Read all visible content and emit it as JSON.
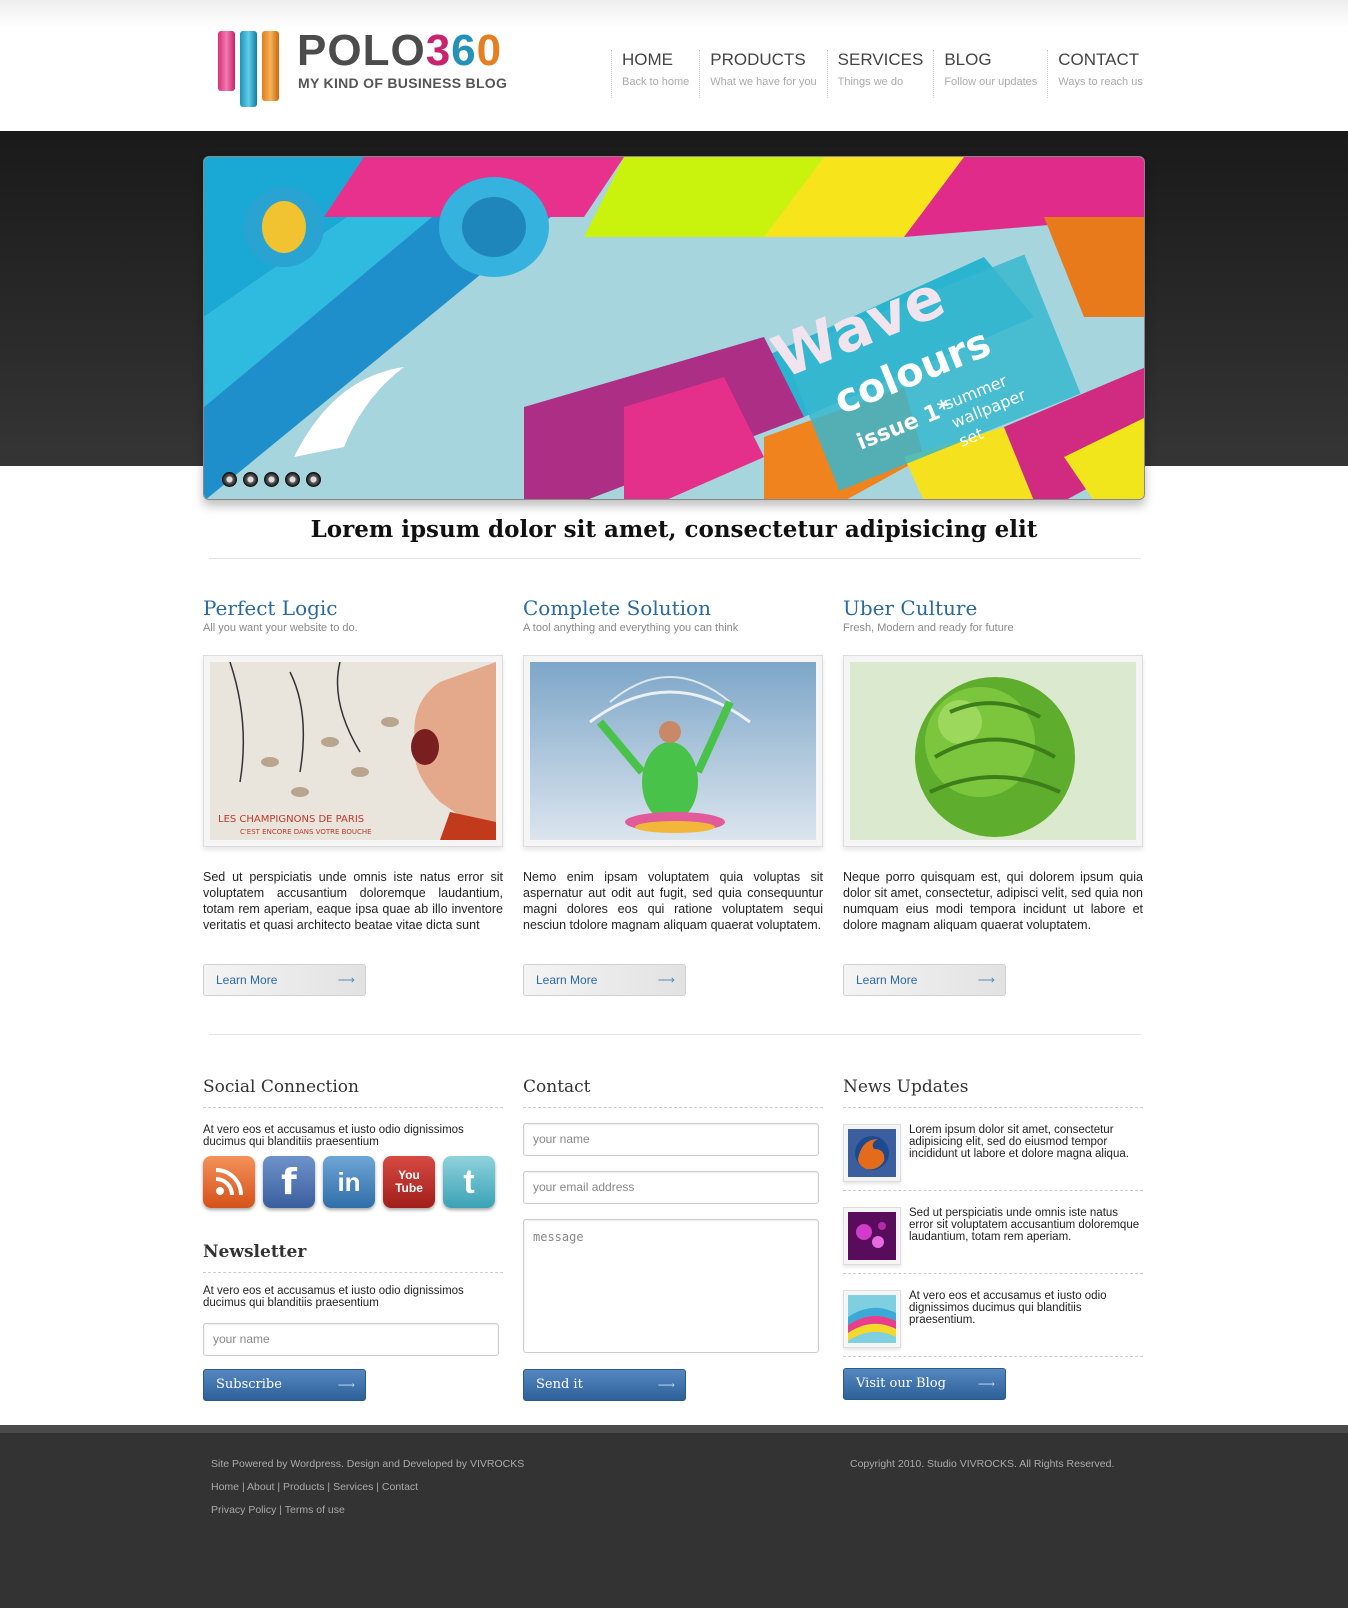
{
  "brand": {
    "name_prefix": "POLO",
    "name_3": "3",
    "name_6": "6",
    "name_0": "0",
    "tagline": "MY KIND OF BUSINESS BLOG",
    "colors": {
      "pink": "#c8236d",
      "blue": "#2492b8",
      "orange": "#e4801f"
    }
  },
  "nav": [
    {
      "label": "HOME",
      "sub": "Back to home"
    },
    {
      "label": "PRODUCTS",
      "sub": "What we have for you"
    },
    {
      "label": "SERVICES",
      "sub": "Things we do"
    },
    {
      "label": "BLOG",
      "sub": "Follow our updates"
    },
    {
      "label": "CONTACT",
      "sub": "Ways to reach us"
    }
  ],
  "slider": {
    "art_title": "Wave",
    "art_subtitle": "colours",
    "art_issue": "issue 1*",
    "art_summer": "summer",
    "art_wallpaper": "wallpaper",
    "art_set": "set",
    "dots": 5
  },
  "headline": "Lorem ipsum dolor sit amet, consectetur adipisicing elit",
  "features": [
    {
      "title": "Perfect Logic",
      "sub": "All you want your website to do.",
      "body": "Sed ut perspiciatis unde omnis iste natus error sit voluptatem accusantium doloremque laudantium, totam rem aperiam, eaque ipsa quae ab illo inventore veritatis et quasi architecto beatae vitae dicta sunt",
      "button": "Learn More",
      "image_caption": "LES CHAMPIGNONS DE PARIS",
      "image_caption2": "C'EST ENCORE DANS VOTRE BOUCHE"
    },
    {
      "title": "Complete Solution",
      "sub": "A tool anything and everything you can think",
      "body": "Nemo enim ipsam voluptatem quia voluptas sit aspernatur aut odit aut fugit, sed quia consequuntur magni dolores eos qui ratione voluptatem sequi nesciun tdolore magnam aliquam quaerat voluptatem.",
      "button": "Learn More"
    },
    {
      "title": "Uber Culture",
      "sub": "Fresh, Modern and ready for future",
      "body": "Neque porro quisquam est, qui dolorem ipsum quia dolor sit amet, consectetur, adipisci velit, sed quia non numquam eius modi tempora incidunt ut labore et dolore magnam aliquam quaerat voluptatem.",
      "button": "Learn More"
    }
  ],
  "social": {
    "title": "Social Connection",
    "blurb": "At vero eos et accusamus et iusto odio dignissimos ducimus qui blanditiis praesentium",
    "icons": [
      "rss-icon",
      "facebook-icon",
      "linkedin-icon",
      "youtube-icon",
      "twitter-icon"
    ],
    "facebook_glyph": "f",
    "linkedin_glyph": "in",
    "youtube_glyph_1": "You",
    "youtube_glyph_2": "Tube",
    "twitter_glyph": "t"
  },
  "newsletter": {
    "title": "Newsletter",
    "blurb": "At vero eos et accusamus et iusto odio dignissimos ducimus qui blanditiis praesentium",
    "placeholder": "your name",
    "button": "Subscribe"
  },
  "contact": {
    "title": "Contact",
    "name_placeholder": "your name",
    "email_placeholder": "your email address",
    "message_placeholder": "message",
    "button": "Send it"
  },
  "news": {
    "title": "News Updates",
    "items": [
      {
        "text": "Lorem ipsum dolor sit amet, consectetur adipisicing elit, sed do eiusmod tempor incididunt ut labore et dolore magna aliqua."
      },
      {
        "text": "Sed ut perspiciatis unde omnis iste natus error sit voluptatem accusantium doloremque laudantium, totam rem aperiam."
      },
      {
        "text": "At vero eos et accusamus et iusto odio dignissimos ducimus qui blanditiis praesentium."
      }
    ],
    "button": "Visit our Blog"
  },
  "footer": {
    "credit": "Site Powered by Wordpress. Design and Developed by VIVROCKS",
    "links": [
      "Home",
      "About",
      "Products",
      "Services",
      "Contact"
    ],
    "legal": [
      "Privacy Policy",
      "Terms of use"
    ],
    "separator": "|",
    "copyright": "Copyright 2010. Studio VIVROCKS. All Rights Reserved."
  }
}
